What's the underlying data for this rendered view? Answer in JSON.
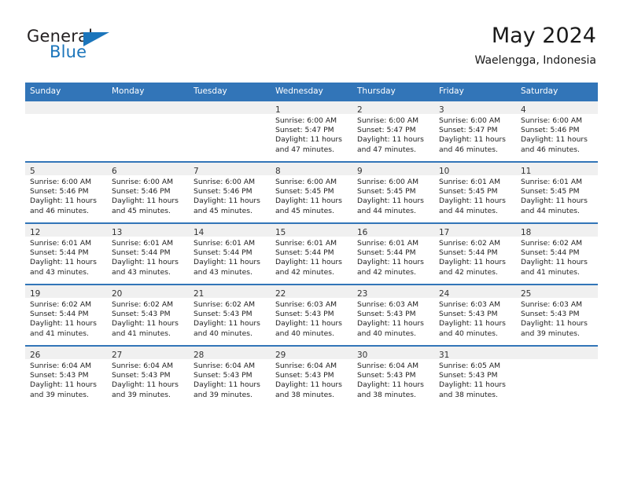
{
  "brand": {
    "name_part1": "General",
    "name_part2": "Blue",
    "logo_icon": "blue-triangle-icon"
  },
  "header": {
    "title": "May 2024",
    "subtitle": "Waelengga, Indonesia",
    "accent_color": "#3275b8",
    "brand_blue": "#1b75bb",
    "daynum_band_color": "#f0f0f0"
  },
  "calendar": {
    "weekday_headers": [
      "Sunday",
      "Monday",
      "Tuesday",
      "Wednesday",
      "Thursday",
      "Friday",
      "Saturday"
    ],
    "weeks": [
      [
        {
          "day": "",
          "sunrise": "",
          "sunset": "",
          "daylight_line1": "",
          "daylight_line2": "",
          "empty": true
        },
        {
          "day": "",
          "sunrise": "",
          "sunset": "",
          "daylight_line1": "",
          "daylight_line2": "",
          "empty": true
        },
        {
          "day": "",
          "sunrise": "",
          "sunset": "",
          "daylight_line1": "",
          "daylight_line2": "",
          "empty": true
        },
        {
          "day": "1",
          "sunrise": "Sunrise: 6:00 AM",
          "sunset": "Sunset: 5:47 PM",
          "daylight_line1": "Daylight: 11 hours",
          "daylight_line2": "and 47 minutes."
        },
        {
          "day": "2",
          "sunrise": "Sunrise: 6:00 AM",
          "sunset": "Sunset: 5:47 PM",
          "daylight_line1": "Daylight: 11 hours",
          "daylight_line2": "and 47 minutes."
        },
        {
          "day": "3",
          "sunrise": "Sunrise: 6:00 AM",
          "sunset": "Sunset: 5:47 PM",
          "daylight_line1": "Daylight: 11 hours",
          "daylight_line2": "and 46 minutes."
        },
        {
          "day": "4",
          "sunrise": "Sunrise: 6:00 AM",
          "sunset": "Sunset: 5:46 PM",
          "daylight_line1": "Daylight: 11 hours",
          "daylight_line2": "and 46 minutes."
        }
      ],
      [
        {
          "day": "5",
          "sunrise": "Sunrise: 6:00 AM",
          "sunset": "Sunset: 5:46 PM",
          "daylight_line1": "Daylight: 11 hours",
          "daylight_line2": "and 46 minutes."
        },
        {
          "day": "6",
          "sunrise": "Sunrise: 6:00 AM",
          "sunset": "Sunset: 5:46 PM",
          "daylight_line1": "Daylight: 11 hours",
          "daylight_line2": "and 45 minutes."
        },
        {
          "day": "7",
          "sunrise": "Sunrise: 6:00 AM",
          "sunset": "Sunset: 5:46 PM",
          "daylight_line1": "Daylight: 11 hours",
          "daylight_line2": "and 45 minutes."
        },
        {
          "day": "8",
          "sunrise": "Sunrise: 6:00 AM",
          "sunset": "Sunset: 5:45 PM",
          "daylight_line1": "Daylight: 11 hours",
          "daylight_line2": "and 45 minutes."
        },
        {
          "day": "9",
          "sunrise": "Sunrise: 6:00 AM",
          "sunset": "Sunset: 5:45 PM",
          "daylight_line1": "Daylight: 11 hours",
          "daylight_line2": "and 44 minutes."
        },
        {
          "day": "10",
          "sunrise": "Sunrise: 6:01 AM",
          "sunset": "Sunset: 5:45 PM",
          "daylight_line1": "Daylight: 11 hours",
          "daylight_line2": "and 44 minutes."
        },
        {
          "day": "11",
          "sunrise": "Sunrise: 6:01 AM",
          "sunset": "Sunset: 5:45 PM",
          "daylight_line1": "Daylight: 11 hours",
          "daylight_line2": "and 44 minutes."
        }
      ],
      [
        {
          "day": "12",
          "sunrise": "Sunrise: 6:01 AM",
          "sunset": "Sunset: 5:44 PM",
          "daylight_line1": "Daylight: 11 hours",
          "daylight_line2": "and 43 minutes."
        },
        {
          "day": "13",
          "sunrise": "Sunrise: 6:01 AM",
          "sunset": "Sunset: 5:44 PM",
          "daylight_line1": "Daylight: 11 hours",
          "daylight_line2": "and 43 minutes."
        },
        {
          "day": "14",
          "sunrise": "Sunrise: 6:01 AM",
          "sunset": "Sunset: 5:44 PM",
          "daylight_line1": "Daylight: 11 hours",
          "daylight_line2": "and 43 minutes."
        },
        {
          "day": "15",
          "sunrise": "Sunrise: 6:01 AM",
          "sunset": "Sunset: 5:44 PM",
          "daylight_line1": "Daylight: 11 hours",
          "daylight_line2": "and 42 minutes."
        },
        {
          "day": "16",
          "sunrise": "Sunrise: 6:01 AM",
          "sunset": "Sunset: 5:44 PM",
          "daylight_line1": "Daylight: 11 hours",
          "daylight_line2": "and 42 minutes."
        },
        {
          "day": "17",
          "sunrise": "Sunrise: 6:02 AM",
          "sunset": "Sunset: 5:44 PM",
          "daylight_line1": "Daylight: 11 hours",
          "daylight_line2": "and 42 minutes."
        },
        {
          "day": "18",
          "sunrise": "Sunrise: 6:02 AM",
          "sunset": "Sunset: 5:44 PM",
          "daylight_line1": "Daylight: 11 hours",
          "daylight_line2": "and 41 minutes."
        }
      ],
      [
        {
          "day": "19",
          "sunrise": "Sunrise: 6:02 AM",
          "sunset": "Sunset: 5:44 PM",
          "daylight_line1": "Daylight: 11 hours",
          "daylight_line2": "and 41 minutes."
        },
        {
          "day": "20",
          "sunrise": "Sunrise: 6:02 AM",
          "sunset": "Sunset: 5:43 PM",
          "daylight_line1": "Daylight: 11 hours",
          "daylight_line2": "and 41 minutes."
        },
        {
          "day": "21",
          "sunrise": "Sunrise: 6:02 AM",
          "sunset": "Sunset: 5:43 PM",
          "daylight_line1": "Daylight: 11 hours",
          "daylight_line2": "and 40 minutes."
        },
        {
          "day": "22",
          "sunrise": "Sunrise: 6:03 AM",
          "sunset": "Sunset: 5:43 PM",
          "daylight_line1": "Daylight: 11 hours",
          "daylight_line2": "and 40 minutes."
        },
        {
          "day": "23",
          "sunrise": "Sunrise: 6:03 AM",
          "sunset": "Sunset: 5:43 PM",
          "daylight_line1": "Daylight: 11 hours",
          "daylight_line2": "and 40 minutes."
        },
        {
          "day": "24",
          "sunrise": "Sunrise: 6:03 AM",
          "sunset": "Sunset: 5:43 PM",
          "daylight_line1": "Daylight: 11 hours",
          "daylight_line2": "and 40 minutes."
        },
        {
          "day": "25",
          "sunrise": "Sunrise: 6:03 AM",
          "sunset": "Sunset: 5:43 PM",
          "daylight_line1": "Daylight: 11 hours",
          "daylight_line2": "and 39 minutes."
        }
      ],
      [
        {
          "day": "26",
          "sunrise": "Sunrise: 6:04 AM",
          "sunset": "Sunset: 5:43 PM",
          "daylight_line1": "Daylight: 11 hours",
          "daylight_line2": "and 39 minutes."
        },
        {
          "day": "27",
          "sunrise": "Sunrise: 6:04 AM",
          "sunset": "Sunset: 5:43 PM",
          "daylight_line1": "Daylight: 11 hours",
          "daylight_line2": "and 39 minutes."
        },
        {
          "day": "28",
          "sunrise": "Sunrise: 6:04 AM",
          "sunset": "Sunset: 5:43 PM",
          "daylight_line1": "Daylight: 11 hours",
          "daylight_line2": "and 39 minutes."
        },
        {
          "day": "29",
          "sunrise": "Sunrise: 6:04 AM",
          "sunset": "Sunset: 5:43 PM",
          "daylight_line1": "Daylight: 11 hours",
          "daylight_line2": "and 38 minutes."
        },
        {
          "day": "30",
          "sunrise": "Sunrise: 6:04 AM",
          "sunset": "Sunset: 5:43 PM",
          "daylight_line1": "Daylight: 11 hours",
          "daylight_line2": "and 38 minutes."
        },
        {
          "day": "31",
          "sunrise": "Sunrise: 6:05 AM",
          "sunset": "Sunset: 5:43 PM",
          "daylight_line1": "Daylight: 11 hours",
          "daylight_line2": "and 38 minutes."
        },
        {
          "day": "",
          "sunrise": "",
          "sunset": "",
          "daylight_line1": "",
          "daylight_line2": "",
          "empty": true
        }
      ]
    ]
  }
}
